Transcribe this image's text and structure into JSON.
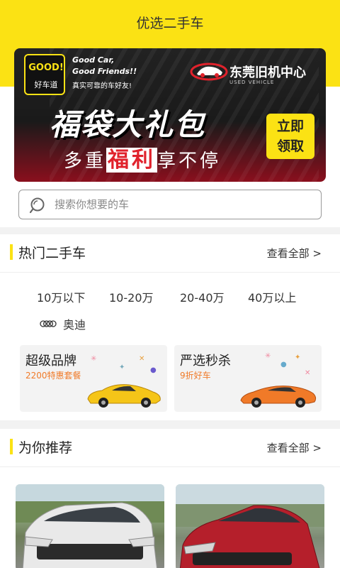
{
  "header": {
    "title": "优选二手车",
    "bg_color": "#fbe214"
  },
  "banner": {
    "logo_text": "GOOD!",
    "logo_cn": "好车道",
    "slogan_line1": "Good Car,",
    "slogan_line2": "Good Friends!!",
    "slogan_cn": "真实可靠的车好友!",
    "partner_name": "东莞旧机中心",
    "partner_sub": "USED VEHICLE",
    "headline": "福袋大礼包",
    "sub_before": "多重",
    "sub_highlight": "福利",
    "sub_after": "享不停",
    "cta": "立即领取"
  },
  "search": {
    "placeholder": "搜索你想要的车"
  },
  "hot": {
    "title": "热门二手车",
    "more": "查看全部 >",
    "price_ranges": [
      "10万以下",
      "10-20万",
      "20-40万",
      "40万以上"
    ],
    "brand": "奥迪",
    "promos": [
      {
        "title": "超级品牌",
        "subtitle": "2200特惠套餐",
        "car_color": "#f5c518"
      },
      {
        "title": "严选秒杀",
        "subtitle": "9折好车",
        "car_color": "#f07a28"
      }
    ]
  },
  "recommend": {
    "title": "为你推荐",
    "more": "查看全部 >",
    "cars": [
      {
        "color": "#e8e8e8",
        "icon": "white-suv-photo"
      },
      {
        "color": "#b51f2b",
        "icon": "red-sedan-photo"
      }
    ]
  }
}
